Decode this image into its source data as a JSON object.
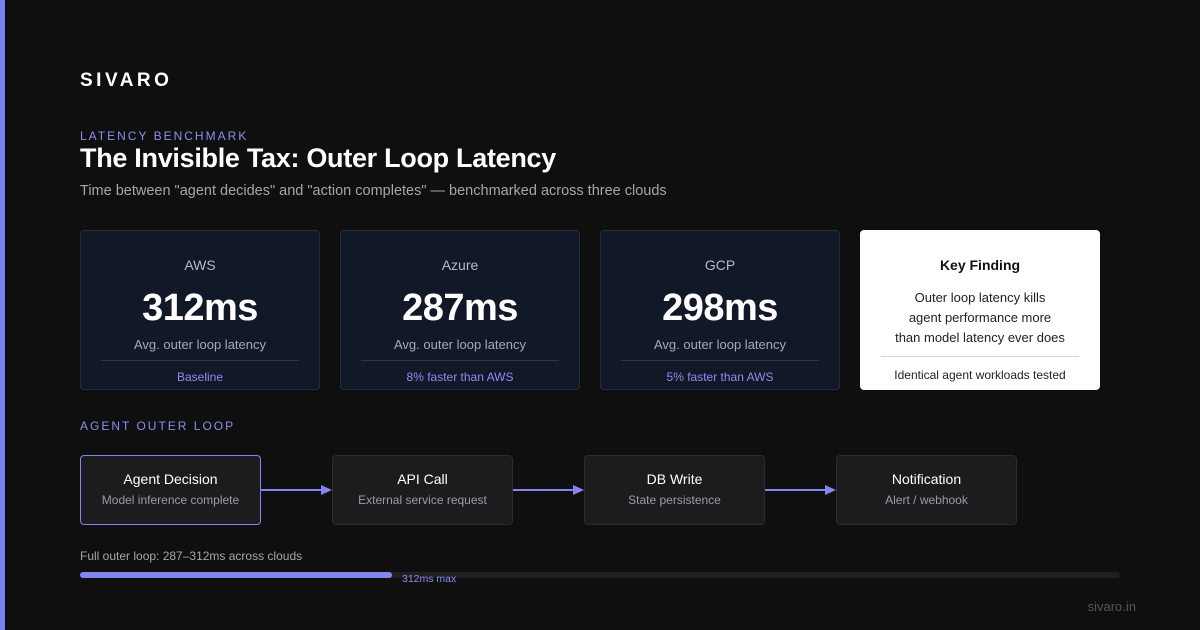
{
  "brand": "SIVARO",
  "header": {
    "eyebrow": "LATENCY BENCHMARK",
    "title": "The Invisible Tax: Outer Loop Latency",
    "subtitle": "Time between \"agent decides\" and \"action completes\" — benchmarked across three clouds"
  },
  "clouds": [
    {
      "name": "AWS",
      "value": "312ms",
      "caption": "Avg. outer loop latency",
      "note": "Baseline"
    },
    {
      "name": "Azure",
      "value": "287ms",
      "caption": "Avg. outer loop latency",
      "note": "8% faster than AWS"
    },
    {
      "name": "GCP",
      "value": "298ms",
      "caption": "Avg. outer loop latency",
      "note": "5% faster than AWS"
    }
  ],
  "finding": {
    "title": "Key Finding",
    "lines": [
      "Outer loop latency kills",
      "agent performance more",
      "than model latency ever does"
    ],
    "note": "Identical agent workloads tested"
  },
  "loop": {
    "label": "AGENT OUTER LOOP",
    "steps": [
      {
        "title": "Agent Decision",
        "desc": "Model inference complete"
      },
      {
        "title": "API Call",
        "desc": "External service request"
      },
      {
        "title": "DB Write",
        "desc": "State persistence"
      },
      {
        "title": "Notification",
        "desc": "Alert / webhook"
      }
    ]
  },
  "progress": {
    "label": "Full outer loop: 287–312ms across clouds",
    "max_label": "312ms max",
    "fraction": 0.3
  },
  "footer": "sivaro.in",
  "colors": {
    "background": "#0f0f10",
    "accent": "#7b7ff0",
    "card": "#111827",
    "finding_card": "#ffffff"
  }
}
